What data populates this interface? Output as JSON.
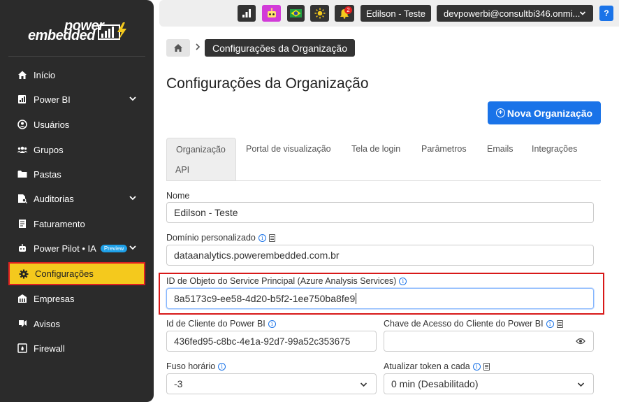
{
  "logo": {
    "line1": "power",
    "line2": "embedded"
  },
  "sidebar": {
    "items": [
      {
        "label": "Início",
        "icon": "home-icon"
      },
      {
        "label": "Power BI",
        "icon": "power-bi-icon",
        "expandable": true
      },
      {
        "label": "Usuários",
        "icon": "user-circle-icon"
      },
      {
        "label": "Grupos",
        "icon": "users-group-icon"
      },
      {
        "label": "Pastas",
        "icon": "folder-icon"
      },
      {
        "label": "Auditorias",
        "icon": "audit-icon",
        "expandable": true
      },
      {
        "label": "Faturamento",
        "icon": "invoice-icon"
      },
      {
        "label": "Power Pilot • IA",
        "icon": "robot-icon",
        "badge": "Preview",
        "expandable": true
      },
      {
        "label": "Configurações",
        "icon": "gear-icon",
        "active": true
      },
      {
        "label": "Empresas",
        "icon": "building-icon"
      },
      {
        "label": "Avisos",
        "icon": "alert-icon"
      },
      {
        "label": "Firewall",
        "icon": "firewall-icon"
      }
    ]
  },
  "topbar": {
    "notification_count": "2",
    "user_name": "Edilson - Teste",
    "account": "devpowerbi@consultbi346.onmi...",
    "help": "?"
  },
  "breadcrumb": {
    "current": "Configurações da Organização"
  },
  "page": {
    "title": "Configurações da Organização",
    "new_button": "Nova Organização"
  },
  "tabs": [
    "Organização",
    "Portal de visualização",
    "Tela de login",
    "Parâmetros",
    "Emails",
    "Integrações",
    "API"
  ],
  "form": {
    "nome_label": "Nome",
    "nome_value": "Edilson - Teste",
    "dominio_label": "Domínio personalizado",
    "dominio_value": "dataanalytics.powerembedded.com.br",
    "sp_label": "ID de Objeto do Service Principal (Azure Analysis Services)",
    "sp_value": "8a5173c9-ee58-4d20-b5f2-1ee750ba8fe9",
    "client_id_label": "Id de Cliente do Power BI",
    "client_id_value": "436fed95-c8bc-4e1a-92d7-99a52c353675",
    "client_key_label": "Chave de Acesso do Cliente do Power BI",
    "client_key_value": "",
    "timezone_label": "Fuso horário",
    "timezone_value": "-3",
    "token_label": "Atualizar token a cada",
    "token_value": "0 min (Desabilitado)"
  },
  "colors": {
    "accent": "#1a73e8",
    "active_nav": "#f4c91d",
    "highlight": "#d81818",
    "sidebar": "#2b2b2b"
  }
}
